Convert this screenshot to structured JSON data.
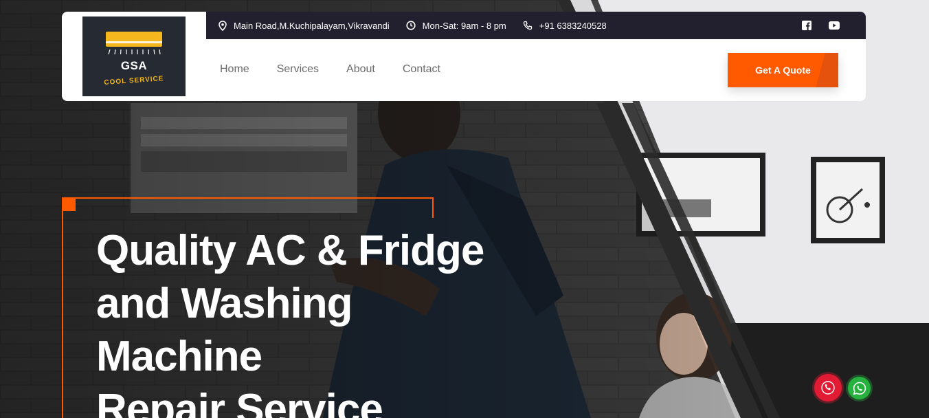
{
  "logo": {
    "brand": "GSA",
    "tagline": "COOL SERVICE",
    "accent_color": "#f4b71e",
    "background_color": "#262a33"
  },
  "topbar": {
    "address": "Main Road,M.Kuchipalayam,Vikravandi",
    "hours": "Mon-Sat: 9am - 8 pm",
    "phone": "+91 6383240528",
    "address_icon": "location-pin-icon",
    "hours_icon": "clock-icon",
    "phone_icon": "phone-icon",
    "social_icons": [
      "facebook-icon",
      "youtube-icon"
    ],
    "background_color": "#221f2e"
  },
  "nav": {
    "items": [
      "Home",
      "Services",
      "About",
      "Contact"
    ]
  },
  "cta": {
    "label": "Get A Quote",
    "color": "#ff5a00"
  },
  "hero": {
    "title_lines": [
      "Quality AC & Fridge",
      "and Washing",
      "Machine",
      "Repair Service"
    ],
    "frame_color": "#ff5a00"
  },
  "floating": {
    "call_icon": "phone-call-icon",
    "call_color": "#e21b35",
    "whatsapp_icon": "whatsapp-icon",
    "whatsapp_color": "#27b23f"
  }
}
